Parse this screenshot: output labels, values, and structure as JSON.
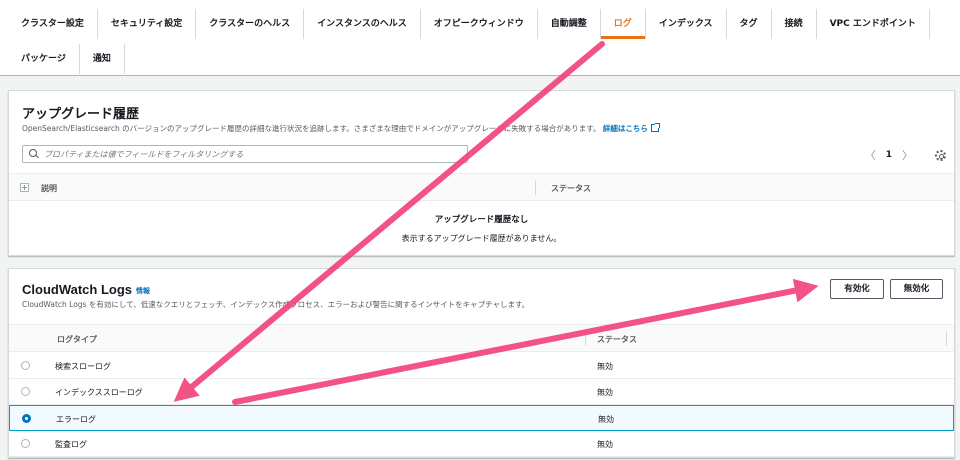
{
  "tabs": {
    "row1": [
      "クラスター設定",
      "セキュリティ設定",
      "クラスターのヘルス",
      "インスタンスのヘルス",
      "オフピークウィンドウ",
      "自動調整",
      "ログ",
      "インデックス",
      "タグ",
      "接続",
      "VPC エンドポイント"
    ],
    "row2": [
      "パッケージ",
      "通知"
    ],
    "active": "ログ"
  },
  "upgrade": {
    "title": "アップグレード履歴",
    "description": "OpenSearch/Elasticsearch のバージョンのアップグレード履歴の詳細な進行状況を追跡します。さまざまな理由でドメインがアップグレードに失敗する場合があります。",
    "details_link": "詳細はこちら",
    "search_placeholder": "プロパティまたは値でフィールドをフィルタリングする",
    "page": "1",
    "col_description": "説明",
    "col_status": "ステータス",
    "empty_title": "アップグレード履歴なし",
    "empty_desc": "表示するアップグレード履歴がありません。"
  },
  "cloudwatch": {
    "title": "CloudWatch Logs",
    "info": "情報",
    "description": "CloudWatch Logs を有効にして、低速なクエリとフェッチ、インデックス作成プロセス、エラーおよび警告に関するインサイトをキャプチャします。",
    "enable_label": "有効化",
    "disable_label": "無効化",
    "col_log_type": "ログタイプ",
    "col_status": "ステータス",
    "rows": [
      {
        "name": "検索スローログ",
        "status": "無効",
        "selected": false
      },
      {
        "name": "インデックススローログ",
        "status": "無効",
        "selected": false
      },
      {
        "name": "エラーログ",
        "status": "無効",
        "selected": true
      },
      {
        "name": "監査ログ",
        "status": "無効",
        "selected": false
      }
    ]
  },
  "colors": {
    "accent": "#ec7211",
    "annotation_arrow": "#f2457a",
    "link": "#0073bb"
  }
}
